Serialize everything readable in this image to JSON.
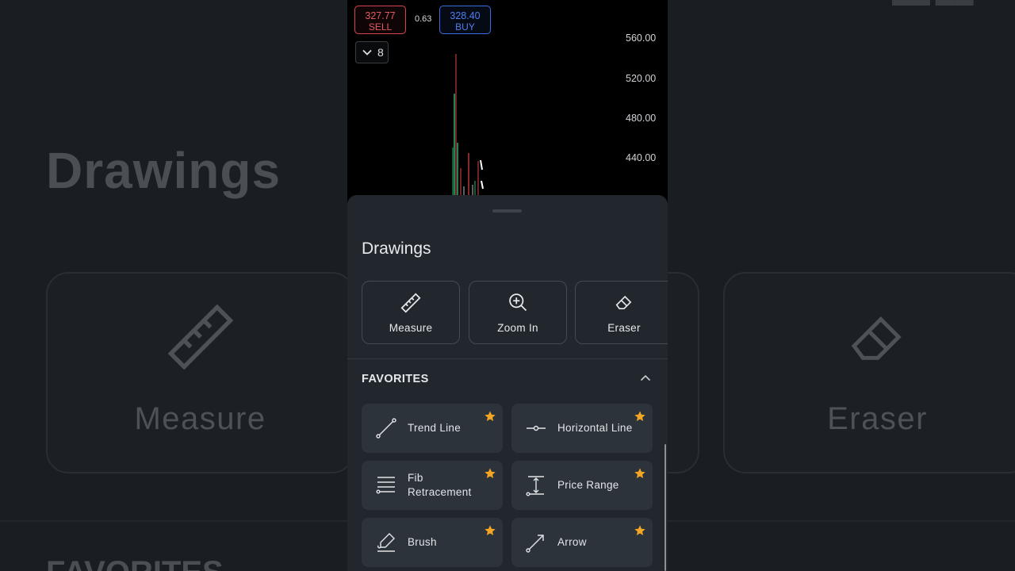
{
  "background": {
    "title": "Drawings",
    "cards": [
      "Measure",
      "Eraser"
    ],
    "favorites": "FAVORITES"
  },
  "chart": {
    "sell_price": "327.77",
    "sell_label": "SELL",
    "spread": "0.63",
    "buy_price": "328.40",
    "buy_label": "BUY",
    "indicator_count": "8",
    "y_labels": [
      "560.00",
      "520.00",
      "480.00",
      "440.00"
    ]
  },
  "sheet": {
    "title": "Drawings",
    "tools": [
      {
        "label": "Measure",
        "icon": "ruler-icon"
      },
      {
        "label": "Zoom In",
        "icon": "zoom-in-icon"
      },
      {
        "label": "Eraser",
        "icon": "eraser-icon"
      }
    ],
    "favorites_title": "FAVORITES",
    "favorites": [
      {
        "label": "Trend Line",
        "icon": "trend-line-icon",
        "starred": true
      },
      {
        "label": "Horizontal Line",
        "icon": "horizontal-line-icon",
        "starred": true
      },
      {
        "label": "Fib\nRetracement",
        "icon": "fib-retracement-icon",
        "starred": true
      },
      {
        "label": "Price Range",
        "icon": "price-range-icon",
        "starred": true
      },
      {
        "label": "Brush",
        "icon": "brush-icon",
        "starred": true
      },
      {
        "label": "Arrow",
        "icon": "arrow-icon",
        "starred": true
      }
    ]
  },
  "colors": {
    "sell": "#e25a60",
    "buy": "#4d7ff0",
    "star": "#f5a623",
    "sheet_bg": "#22272e",
    "item_bg": "#2d333b"
  }
}
